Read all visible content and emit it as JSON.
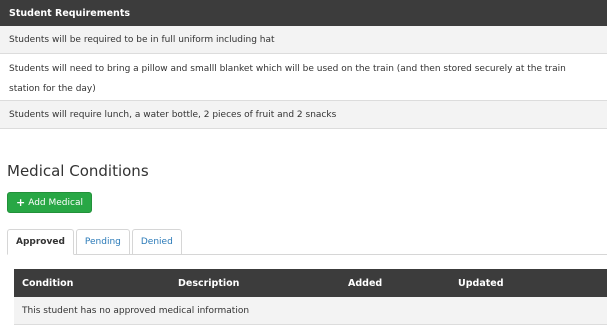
{
  "requirements": {
    "title": "Student Requirements",
    "rows": [
      "Students will be required to be in full uniform including hat",
      "Students will need to bring a pillow and smalll blanket which will be used on the train (and then stored securely at the train station for the day)",
      "Students will require lunch, a water bottle, 2 pieces of fruit and 2 snacks"
    ]
  },
  "medical": {
    "title": "Medical Conditions",
    "add_button": "Add Medical",
    "tabs": [
      "Approved",
      "Pending",
      "Denied"
    ],
    "active_tab": "Approved",
    "columns": [
      "Condition",
      "Description",
      "Added",
      "Updated"
    ],
    "empty_message": "This student has no approved medical information"
  },
  "colors": {
    "header_bg": "#3c3c3c",
    "add_button_bg": "#28a745",
    "tab_link": "#2a7ab8"
  }
}
